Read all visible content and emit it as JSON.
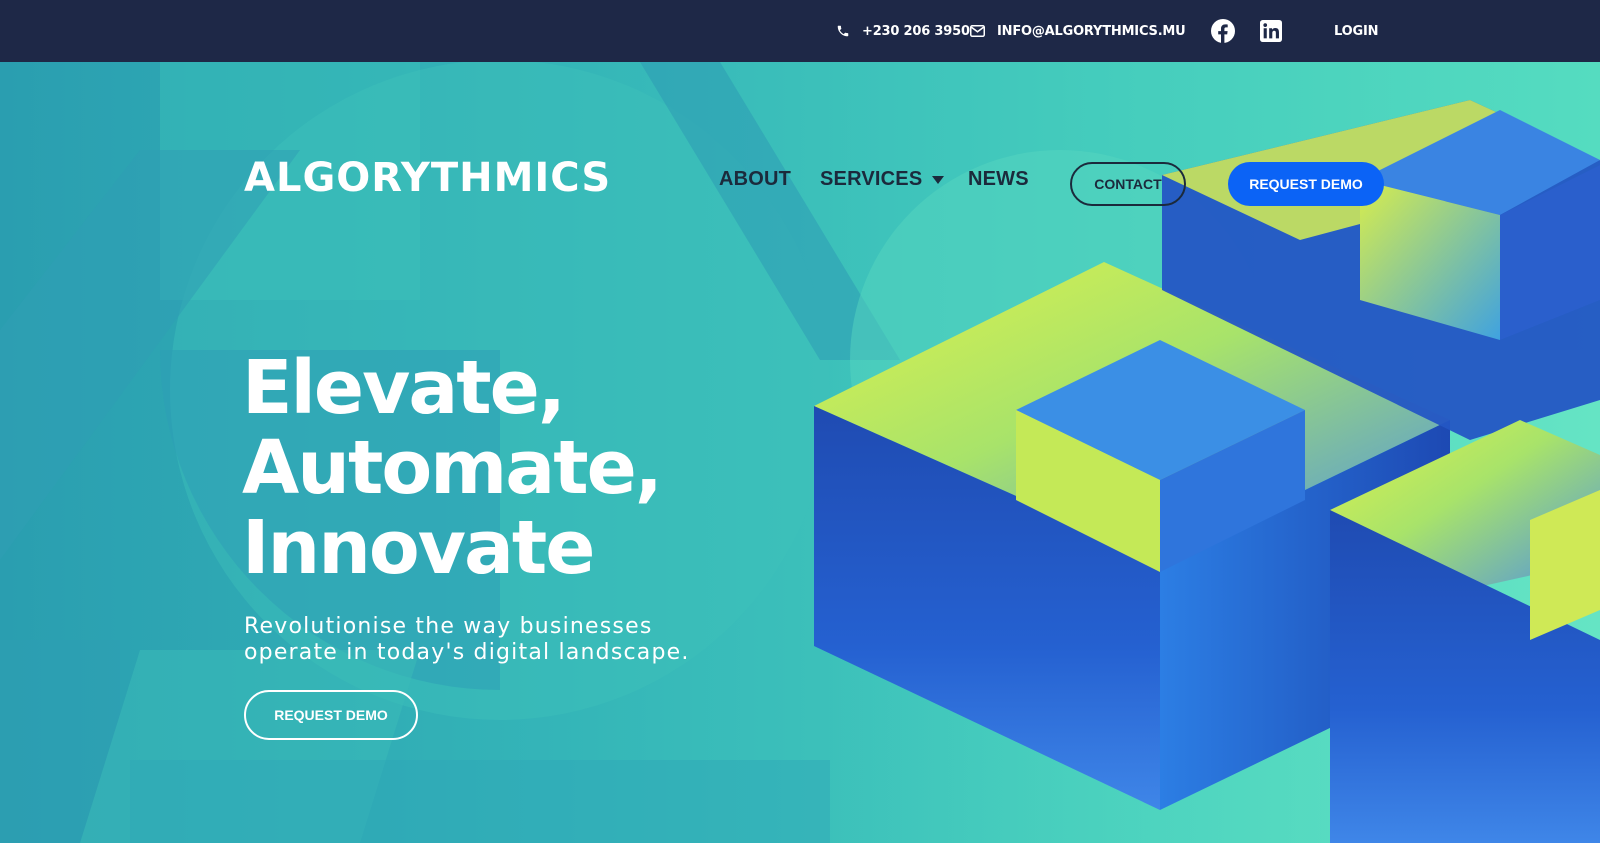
{
  "topbar": {
    "phone": "+230 206 3950",
    "email": "INFO@ALGORYTHMICS.MU",
    "login": "LOGIN",
    "icons": [
      "phone-icon",
      "envelope-icon",
      "facebook-icon",
      "linkedin-icon"
    ]
  },
  "nav": {
    "logo": "ALGORYTHMICS",
    "about": "ABOUT",
    "services": "SERVICES",
    "news": "NEWS",
    "contact": "CONTACT",
    "request_demo": "REQUEST DEMO"
  },
  "hero": {
    "headline": [
      "Elevate,",
      "Automate,",
      "Innovate"
    ],
    "subheadline": [
      "Revolutionise the way businesses",
      "operate in today's digital landscape."
    ],
    "cta": "REQUEST DEMO"
  },
  "colors": {
    "topbar_bg": "#1e2847",
    "teal": "#2bb3b3",
    "mint": "#55dcc0",
    "brand_blue": "#0b63f6",
    "cube_blue": "#1f4fc0",
    "cube_yellow": "#d8f04a",
    "dark_text": "#1b2a3c"
  }
}
